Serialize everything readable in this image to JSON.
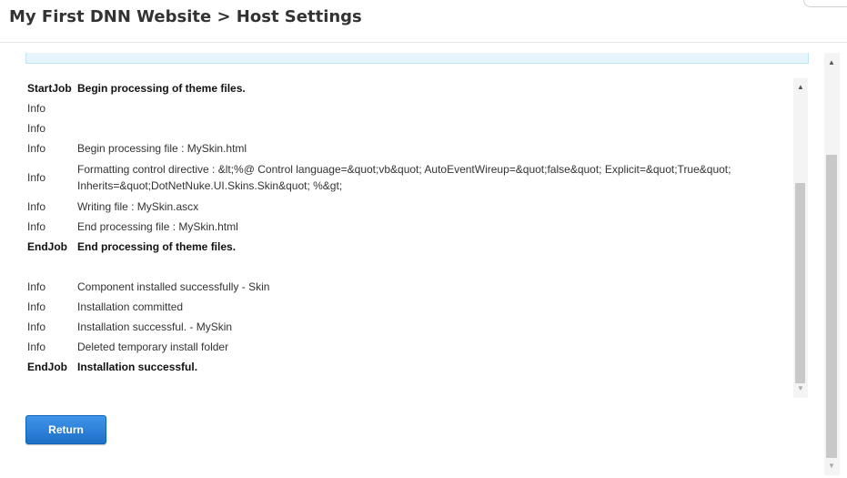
{
  "header": {
    "title": "My First DNN Website > Host Settings"
  },
  "log": {
    "rows": [
      {
        "type": "StartJob",
        "message": "Begin processing of theme files.",
        "kind": "job"
      },
      {
        "type": "Info",
        "message": "",
        "kind": "info"
      },
      {
        "type": "Info",
        "message": "",
        "kind": "info"
      },
      {
        "type": "Info",
        "message": "Begin processing file : MySkin.html",
        "kind": "info"
      },
      {
        "type": "Info",
        "message": "Formatting control directive : &lt;%@ Control language=&quot;vb&quot; AutoEventWireup=&quot;false&quot; Explicit=&quot;True&quot; Inherits=&quot;DotNetNuke.UI.Skins.Skin&quot; %&gt;",
        "kind": "info-tall"
      },
      {
        "type": "Info",
        "message": "Writing file : MySkin.ascx",
        "kind": "info"
      },
      {
        "type": "Info",
        "message": "End processing file : MySkin.html",
        "kind": "info"
      },
      {
        "type": "EndJob",
        "message": "End processing of theme files.",
        "kind": "job"
      },
      {
        "type": "",
        "message": "",
        "kind": "blank"
      },
      {
        "type": "Info",
        "message": "Component installed successfully - Skin",
        "kind": "info"
      },
      {
        "type": "Info",
        "message": "Installation committed",
        "kind": "info"
      },
      {
        "type": "Info",
        "message": "Installation successful. - MySkin",
        "kind": "info"
      },
      {
        "type": "Info",
        "message": "Deleted temporary install folder",
        "kind": "info"
      },
      {
        "type": "EndJob",
        "message": "Installation successful.",
        "kind": "job"
      }
    ]
  },
  "actions": {
    "return_label": "Return"
  },
  "icons": {
    "scroll_up": "triangle-up-icon",
    "scroll_down": "triangle-down-icon"
  },
  "colors": {
    "button": "#2a7fd9",
    "banner": "#e6f4fb",
    "scrollbar_thumb": "#c8c8c8"
  }
}
